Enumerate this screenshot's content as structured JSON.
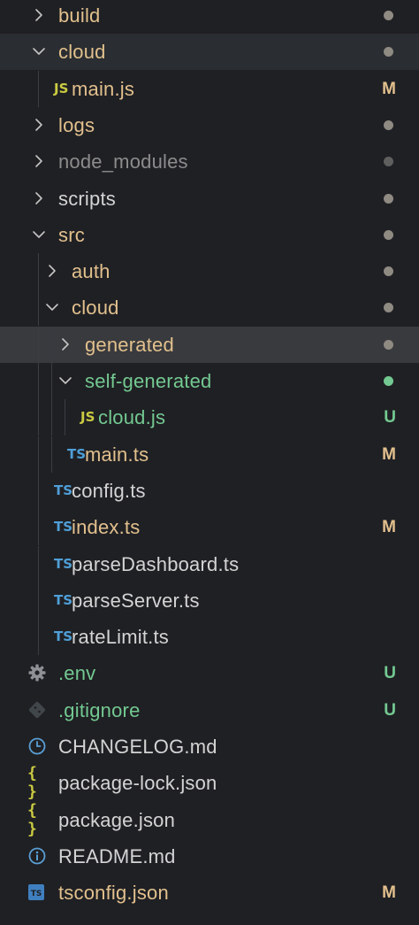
{
  "colors": {
    "modified": "#e2c08d",
    "untracked": "#73c991",
    "ignored": "#8c8c8c",
    "default": "#d4d4d4",
    "dot_default": "#8f8a82",
    "dot_ignored": "#5f5f5f",
    "dot_untracked": "#73c991"
  },
  "explorer": {
    "items": [
      {
        "label": "build",
        "kind": "folder",
        "expanded": false,
        "depth": 0,
        "status": "dot",
        "color": "modified"
      },
      {
        "label": "cloud",
        "kind": "folder",
        "expanded": true,
        "depth": 0,
        "status": "dot",
        "color": "modified"
      },
      {
        "label": "main.js",
        "kind": "js-file",
        "depth": 1,
        "badge": "M",
        "color": "modified"
      },
      {
        "label": "logs",
        "kind": "folder",
        "expanded": false,
        "depth": 0,
        "status": "dot",
        "color": "modified"
      },
      {
        "label": "node_modules",
        "kind": "folder",
        "expanded": false,
        "depth": 0,
        "status": "dot",
        "color": "ignored"
      },
      {
        "label": "scripts",
        "kind": "folder",
        "expanded": false,
        "depth": 0,
        "color": "default"
      },
      {
        "label": "src",
        "kind": "folder",
        "expanded": true,
        "depth": 0,
        "status": "dot",
        "color": "modified"
      },
      {
        "label": "auth",
        "kind": "folder",
        "expanded": false,
        "depth": 1,
        "status": "dot",
        "color": "modified"
      },
      {
        "label": "cloud",
        "kind": "folder",
        "expanded": true,
        "depth": 1,
        "status": "dot",
        "color": "modified"
      },
      {
        "label": "generated",
        "kind": "folder",
        "expanded": false,
        "depth": 2,
        "status": "dot",
        "color": "modified"
      },
      {
        "label": "self-generated",
        "kind": "folder",
        "expanded": true,
        "depth": 2,
        "status": "dot",
        "color": "untracked"
      },
      {
        "label": "cloud.js",
        "kind": "js-file",
        "depth": 3,
        "badge": "U",
        "color": "untracked"
      },
      {
        "label": "main.ts",
        "kind": "ts-file",
        "depth": 2,
        "badge": "M",
        "color": "modified"
      },
      {
        "label": "config.ts",
        "kind": "ts-file",
        "depth": 1,
        "color": "default"
      },
      {
        "label": "index.ts",
        "kind": "ts-file",
        "depth": 1,
        "badge": "M",
        "color": "modified"
      },
      {
        "label": "parseDashboard.ts",
        "kind": "ts-file",
        "depth": 1,
        "color": "default"
      },
      {
        "label": "parseServer.ts",
        "kind": "ts-file",
        "depth": 1,
        "color": "default"
      },
      {
        "label": "rateLimit.ts",
        "kind": "ts-file",
        "depth": 1,
        "color": "default"
      },
      {
        "label": ".env",
        "kind": "gear-file",
        "depth": 0,
        "badge": "U",
        "color": "untracked"
      },
      {
        "label": ".gitignore",
        "kind": "git-file",
        "depth": 0,
        "badge": "U",
        "color": "untracked"
      },
      {
        "label": "CHANGELOG.md",
        "kind": "clock-file",
        "depth": 0,
        "color": "default"
      },
      {
        "label": "package-lock.json",
        "kind": "json-file",
        "depth": 0,
        "color": "default"
      },
      {
        "label": "package.json",
        "kind": "json-file",
        "depth": 0,
        "color": "default"
      },
      {
        "label": "README.md",
        "kind": "info-file",
        "depth": 0,
        "color": "default"
      },
      {
        "label": "tsconfig.json",
        "kind": "tsconfig-file",
        "depth": 0,
        "badge": "M",
        "color": "modified"
      }
    ],
    "icon_glyphs": {
      "js": "JS",
      "ts": "TS",
      "json": "{ }"
    }
  }
}
